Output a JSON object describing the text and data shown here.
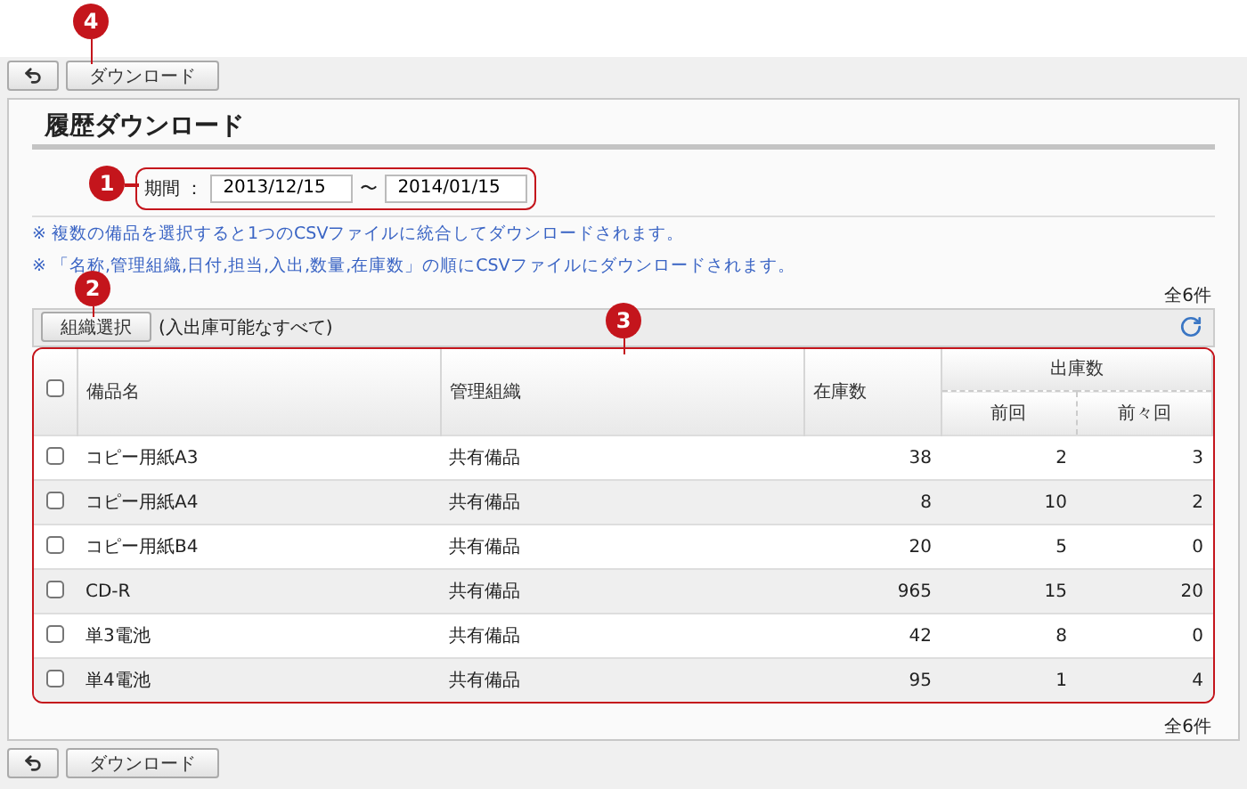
{
  "top_toolbar": {
    "download_button": "ダウンロード"
  },
  "title": "履歴ダウンロード",
  "period": {
    "label": "期間 ：",
    "from": "2013/12/15",
    "separator": "〜",
    "to": "2014/01/15"
  },
  "notes": [
    "※ 複数の備品を選択すると1つのCSVファイルに統合してダウンロードされます。",
    "※ 「名称,管理組織,日付,担当,入出,数量,在庫数」の順にCSVファイルにダウンロードされます。"
  ],
  "count_top": "全6件",
  "table_toolbar": {
    "button": "組織選択",
    "filter": "(入出庫可能なすべて)"
  },
  "table": {
    "header_checked": false,
    "columns": [
      "備品名",
      "管理組織",
      "在庫数"
    ],
    "group_column": "出庫数",
    "sub_columns": [
      "前回",
      "前々回"
    ],
    "rows": [
      {
        "checked": false,
        "cells": [
          "コピー用紙A3",
          "共有備品",
          "38",
          "2",
          "3"
        ]
      },
      {
        "checked": false,
        "cells": [
          "コピー用紙A4",
          "共有備品",
          "8",
          "10",
          "2"
        ]
      },
      {
        "checked": false,
        "cells": [
          "コピー用紙B4",
          "共有備品",
          "20",
          "5",
          "0"
        ]
      },
      {
        "checked": false,
        "cells": [
          "CD-R",
          "共有備品",
          "965",
          "15",
          "20"
        ]
      },
      {
        "checked": false,
        "cells": [
          "単3電池",
          "共有備品",
          "42",
          "8",
          "0"
        ]
      },
      {
        "checked": false,
        "cells": [
          "単4電池",
          "共有備品",
          "95",
          "1",
          "4"
        ]
      }
    ]
  },
  "count_bottom": "全6件",
  "bottom_toolbar": {
    "download_button": "ダウンロード"
  },
  "callouts": [
    {
      "label": "1"
    },
    {
      "label": "2"
    },
    {
      "label": "3"
    },
    {
      "label": "4"
    }
  ]
}
